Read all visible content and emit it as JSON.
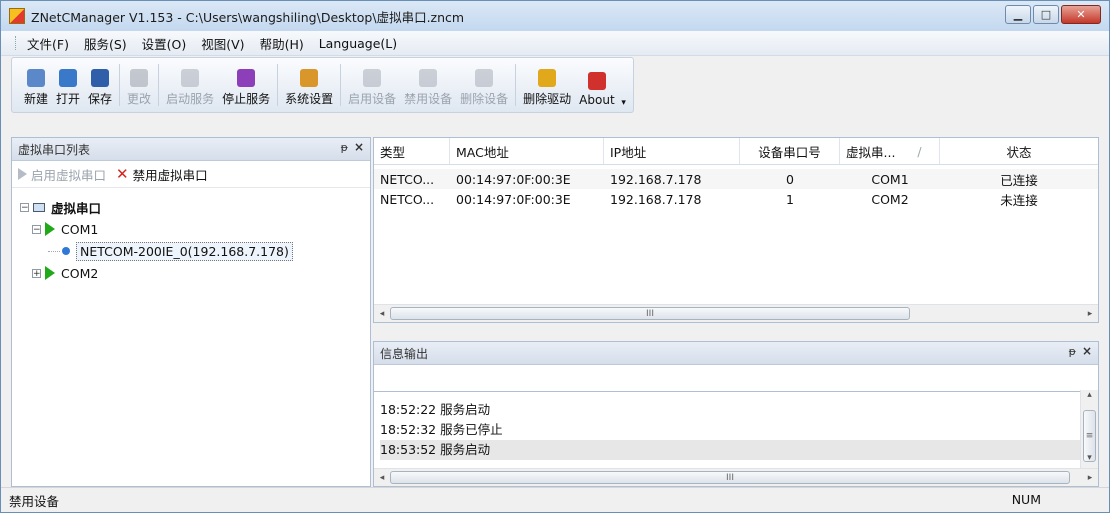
{
  "window": {
    "title": "ZNetCManager V1.153 - C:\\Users\\wangshiling\\Desktop\\虚拟串口.zncm",
    "minimize_glyph": "▁",
    "maximize_glyph": "□",
    "close_glyph": "✕"
  },
  "menu": [
    {
      "label": "文件(F)"
    },
    {
      "label": "服务(S)"
    },
    {
      "label": "设置(O)"
    },
    {
      "label": "视图(V)"
    },
    {
      "label": "帮助(H)"
    },
    {
      "label": "Language(L)"
    }
  ],
  "toolbar": {
    "buttons": [
      {
        "label": "新建",
        "icon": "new-file-icon",
        "color": "#5a88c8",
        "enabled": true
      },
      {
        "label": "打开",
        "icon": "open-icon",
        "color": "#3a78c9",
        "enabled": true
      },
      {
        "label": "保存",
        "icon": "save-icon",
        "color": "#2f5fa8",
        "enabled": true
      },
      {
        "label": "更改",
        "icon": "edit-icon",
        "color": "#8a8f98",
        "enabled": false
      },
      {
        "label": "启动服务",
        "icon": "start-service-icon",
        "color": "#9aa0aa",
        "enabled": false
      },
      {
        "label": "停止服务",
        "icon": "stop-service-icon",
        "color": "#8c3fb8",
        "enabled": true
      },
      {
        "label": "系统设置",
        "icon": "settings-icon",
        "color": "#d9962a",
        "enabled": true
      },
      {
        "label": "启用设备",
        "icon": "enable-device-icon",
        "color": "#9aa0aa",
        "enabled": false
      },
      {
        "label": "禁用设备",
        "icon": "disable-device-icon",
        "color": "#9aa0aa",
        "enabled": false
      },
      {
        "label": "删除设备",
        "icon": "delete-device-icon",
        "color": "#9aa0aa",
        "enabled": false
      },
      {
        "label": "删除驱动",
        "icon": "delete-driver-icon",
        "color": "#e0a81a",
        "enabled": true
      },
      {
        "label": "About",
        "icon": "about-icon",
        "color": "#d0312d",
        "enabled": true
      }
    ]
  },
  "left_pane": {
    "title": "虚拟串口列表",
    "pin_glyph": "ᴩ",
    "close_glyph": "×",
    "enable_label": "启用虚拟串口",
    "disable_label": "禁用虚拟串口",
    "tree": {
      "root": "虚拟串口",
      "com1": "COM1",
      "com1_child": "NETCOM-200IE_0(192.168.7.178)",
      "com2": "COM2"
    }
  },
  "device_table": {
    "columns": [
      "类型",
      "MAC地址",
      "IP地址",
      "设备串口号",
      "虚拟串...",
      "状态"
    ],
    "sort_glyph": "/",
    "rows": [
      [
        "NETCO...",
        "00:14:97:0F:00:3E",
        "192.168.7.178",
        "0",
        "COM1",
        "已连接"
      ],
      [
        "NETCO...",
        "00:14:97:0F:00:3E",
        "192.168.7.178",
        "1",
        "COM2",
        "未连接"
      ]
    ],
    "scroll_grip": "III"
  },
  "output_pane": {
    "title": "信息输出",
    "pin_glyph": "ᵽ",
    "close_glyph": "×",
    "logs": [
      "18:52:22 服务启动",
      "18:52:32 服务已停止",
      "18:53:52 服务启动"
    ],
    "scroll_grip": "III"
  },
  "status": {
    "left": "禁用设备",
    "num": "NUM"
  }
}
